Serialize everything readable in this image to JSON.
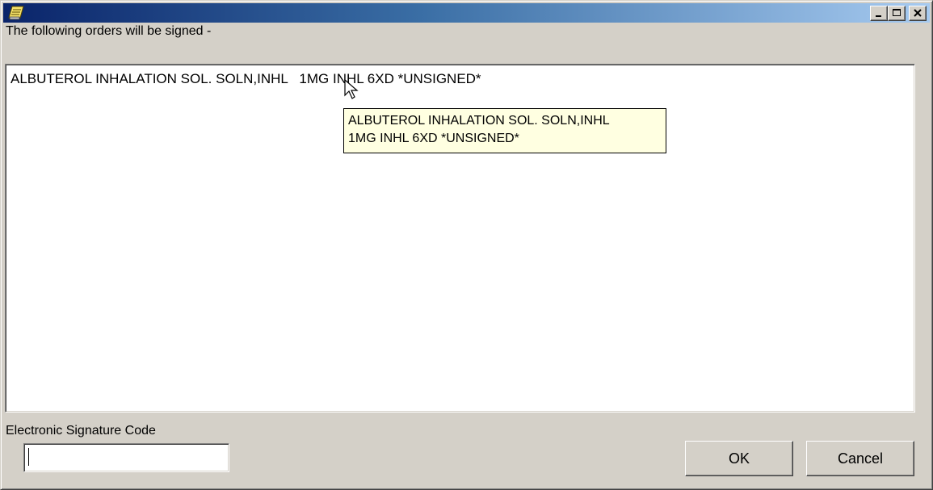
{
  "titlebar": {
    "icon": "notepad-icon",
    "minimize_icon": "minimize-icon",
    "maximize_icon": "maximize-icon",
    "close_icon": "close-icon",
    "gradient_start": "#0a246a",
    "gradient_end": "#a6caf0"
  },
  "orders": {
    "heading": "The following orders will be signed -",
    "items": [
      "ALBUTEROL INHALATION SOL. SOLN,INHL   1MG INHL 6XD *UNSIGNED*"
    ],
    "tooltip_lines": [
      "ALBUTEROL INHALATION SOL. SOLN,INHL",
      "1MG INHL 6XD *UNSIGNED*"
    ]
  },
  "signature": {
    "label": "Electronic Signature Code",
    "value": ""
  },
  "buttons": {
    "ok": "OK",
    "cancel": "Cancel"
  },
  "colors": {
    "face": "#d4d0c8",
    "tooltip_bg": "#ffffe1"
  }
}
